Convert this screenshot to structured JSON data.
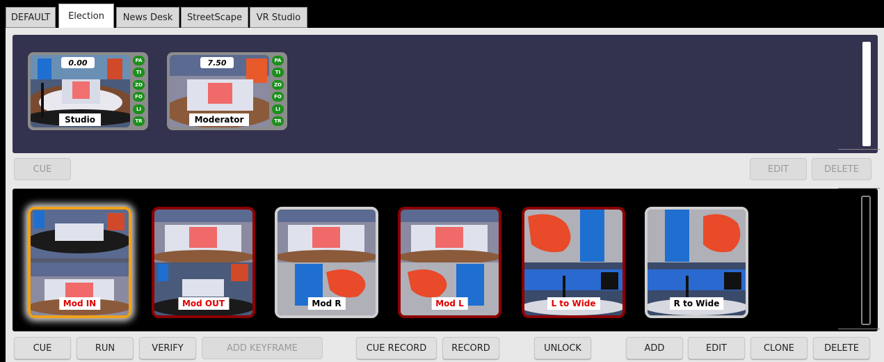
{
  "tabs": [
    "DEFAULT",
    "Election",
    "News Desk",
    "StreetScape",
    "VR Studio"
  ],
  "active_tab": "Election",
  "scenes": [
    {
      "name": "Studio",
      "time": "0.00",
      "badges": [
        "PA",
        "TI",
        "ZO",
        "FO",
        "LI",
        "TR"
      ]
    },
    {
      "name": "Moderator",
      "time": "7.50",
      "badges": [
        "PA",
        "TI",
        "ZO",
        "FO",
        "LI",
        "TR"
      ]
    }
  ],
  "scene_buttons": {
    "cue": "CUE",
    "edit": "EDIT",
    "delete": "DELETE"
  },
  "animations": [
    {
      "name": "Mod IN",
      "state": "active",
      "label_color": "red"
    },
    {
      "name": "Mod OUT",
      "state": "red",
      "label_color": "red"
    },
    {
      "name": "Mod R",
      "state": "normal",
      "label_color": "black"
    },
    {
      "name": "Mod L",
      "state": "red",
      "label_color": "red"
    },
    {
      "name": "L to Wide",
      "state": "red",
      "label_color": "red"
    },
    {
      "name": "R to Wide",
      "state": "normal",
      "label_color": "black"
    }
  ],
  "bottom_buttons": {
    "cue": "CUE",
    "run": "RUN",
    "verify": "VERIFY",
    "add_keyframe": "ADD KEYFRAME",
    "cue_record": "CUE RECORD",
    "record": "RECORD",
    "unlock": "UNLOCK",
    "add": "ADD",
    "edit": "EDIT",
    "clone": "CLONE",
    "delete": "DELETE"
  },
  "colors": {
    "scene_panel": "#33324f",
    "active_border": "#f0a21a",
    "armed_border": "#8b0000",
    "badge": "#1b8f1b"
  }
}
